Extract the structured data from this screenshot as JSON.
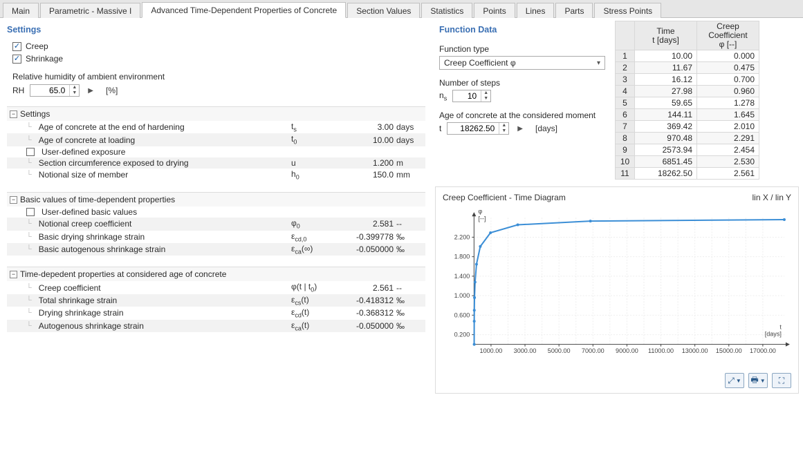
{
  "tabs": [
    "Main",
    "Parametric - Massive I",
    "Advanced Time-Dependent Properties of Concrete",
    "Section Values",
    "Statistics",
    "Points",
    "Lines",
    "Parts",
    "Stress Points"
  ],
  "active_tab": 2,
  "settings_title": "Settings",
  "chk_creep": "Creep",
  "chk_shrink": "Shrinkage",
  "rh_label": "Relative humidity of ambient environment",
  "rh_prefix": "RH",
  "rh_value": "65.0",
  "rh_unit": "[%]",
  "group1": {
    "title": "Settings",
    "rows": [
      {
        "label": "Age of concrete at the end of hardening",
        "sym": "t<sub>s</sub>",
        "val": "3.00",
        "unit": "days"
      },
      {
        "label": "Age of concrete at loading",
        "sym": "t<sub>0</sub>",
        "val": "10.00",
        "unit": "days"
      },
      {
        "chk": true,
        "label": "User-defined exposure",
        "sym": "",
        "val": "",
        "unit": ""
      },
      {
        "label": "Section circumference exposed to drying",
        "sym": "u",
        "val": "1.200",
        "unit": "m"
      },
      {
        "label": "Notional size of member",
        "sym": "h<sub>0</sub>",
        "val": "150.0",
        "unit": "mm"
      }
    ]
  },
  "group2": {
    "title": "Basic values of time-dependent properties",
    "rows": [
      {
        "chk": true,
        "label": "User-defined basic values",
        "sym": "",
        "val": "",
        "unit": ""
      },
      {
        "label": "Notional creep coefficient",
        "sym": "φ<sub>0</sub>",
        "val": "2.581",
        "unit": "--"
      },
      {
        "label": "Basic drying shrinkage strain",
        "sym": "ε<sub>cd,0</sub>",
        "val": "-0.399778",
        "unit": "‰"
      },
      {
        "label": "Basic autogenous shrinkage strain",
        "sym": "ε<sub>ca</sub>(∞)",
        "val": "-0.050000",
        "unit": "‰"
      }
    ]
  },
  "group3": {
    "title": "Time-depedent properties at considered age of concrete",
    "rows": [
      {
        "label": "Creep coefficient",
        "sym": "φ(t | t<sub>0</sub>)",
        "val": "2.561",
        "unit": "--"
      },
      {
        "label": "Total shrinkage strain",
        "sym": "ε<sub>cs</sub>(t)",
        "val": "-0.418312",
        "unit": "‰"
      },
      {
        "label": "Drying shrinkage strain",
        "sym": "ε<sub>cd</sub>(t)",
        "val": "-0.368312",
        "unit": "‰"
      },
      {
        "label": "Autogenous shrinkage strain",
        "sym": "ε<sub>ca</sub>(t)",
        "val": "-0.050000",
        "unit": "‰"
      }
    ]
  },
  "func": {
    "title": "Function Data",
    "type_label": "Function type",
    "type_value": "Creep Coefficient φ",
    "steps_label": "Number of steps",
    "steps_sym": "n<sub>s</sub>",
    "steps_val": "10",
    "age_label": "Age of concrete at the considered moment",
    "age_sym": "t",
    "age_val": "18262.50",
    "age_unit": "[days]"
  },
  "grid_head": {
    "c1a": "Time",
    "c1b": "t [days]",
    "c2a": "Creep Coefficient",
    "c2b": "φ [--]"
  },
  "grid_rows": [
    {
      "i": "1",
      "t": "10.00",
      "c": "0.000"
    },
    {
      "i": "2",
      "t": "11.67",
      "c": "0.475"
    },
    {
      "i": "3",
      "t": "16.12",
      "c": "0.700"
    },
    {
      "i": "4",
      "t": "27.98",
      "c": "0.960"
    },
    {
      "i": "5",
      "t": "59.65",
      "c": "1.278"
    },
    {
      "i": "6",
      "t": "144.11",
      "c": "1.645"
    },
    {
      "i": "7",
      "t": "369.42",
      "c": "2.010"
    },
    {
      "i": "8",
      "t": "970.48",
      "c": "2.291"
    },
    {
      "i": "9",
      "t": "2573.94",
      "c": "2.454"
    },
    {
      "i": "10",
      "t": "6851.45",
      "c": "2.530"
    },
    {
      "i": "11",
      "t": "18262.50",
      "c": "2.561"
    }
  ],
  "chart": {
    "title": "Creep Coefficient - Time Diagram",
    "linlabel": "lin X / lin Y",
    "y_label_top": "φ",
    "y_label_unit": "[--]",
    "x_label": "t",
    "x_label_unit": "[days]",
    "x_ticks": [
      "1000.00",
      "3000.00",
      "5000.00",
      "7000.00",
      "9000.00",
      "11000.00",
      "13000.00",
      "15000.00",
      "17000.00"
    ],
    "y_ticks": [
      "0.200",
      "0.600",
      "1.000",
      "1.400",
      "1.800",
      "2.200"
    ]
  },
  "chart_data": {
    "type": "line",
    "title": "Creep Coefficient - Time Diagram",
    "xlabel": "t [days]",
    "ylabel": "φ [--]",
    "xlim": [
      0,
      18262.5
    ],
    "ylim": [
      0,
      2.6
    ],
    "series": [
      {
        "name": "Creep Coefficient φ",
        "x": [
          10.0,
          11.67,
          16.12,
          27.98,
          59.65,
          144.11,
          369.42,
          970.48,
          2573.94,
          6851.45,
          18262.5
        ],
        "y": [
          0.0,
          0.475,
          0.7,
          0.96,
          1.278,
          1.645,
          2.01,
          2.291,
          2.454,
          2.53,
          2.561
        ]
      }
    ]
  }
}
